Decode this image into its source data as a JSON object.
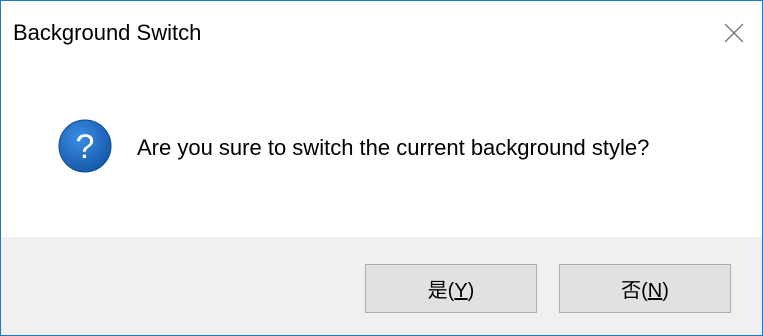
{
  "window": {
    "title": "Background Switch"
  },
  "icons": {
    "close": "close-icon",
    "question": "question-icon"
  },
  "message": {
    "text": "Are you sure to switch the current background style?"
  },
  "buttons": {
    "yes": {
      "prefix": "是(",
      "mnemonic": "Y",
      "suffix": ")"
    },
    "no": {
      "prefix": "否(",
      "mnemonic": "N",
      "suffix": ")"
    }
  },
  "colors": {
    "window_border": "#1e78c8",
    "icon_blue": "#1a5fb4",
    "footer_bg": "#f0f0f0",
    "button_bg": "#e1e1e1",
    "button_border": "#adadad"
  }
}
